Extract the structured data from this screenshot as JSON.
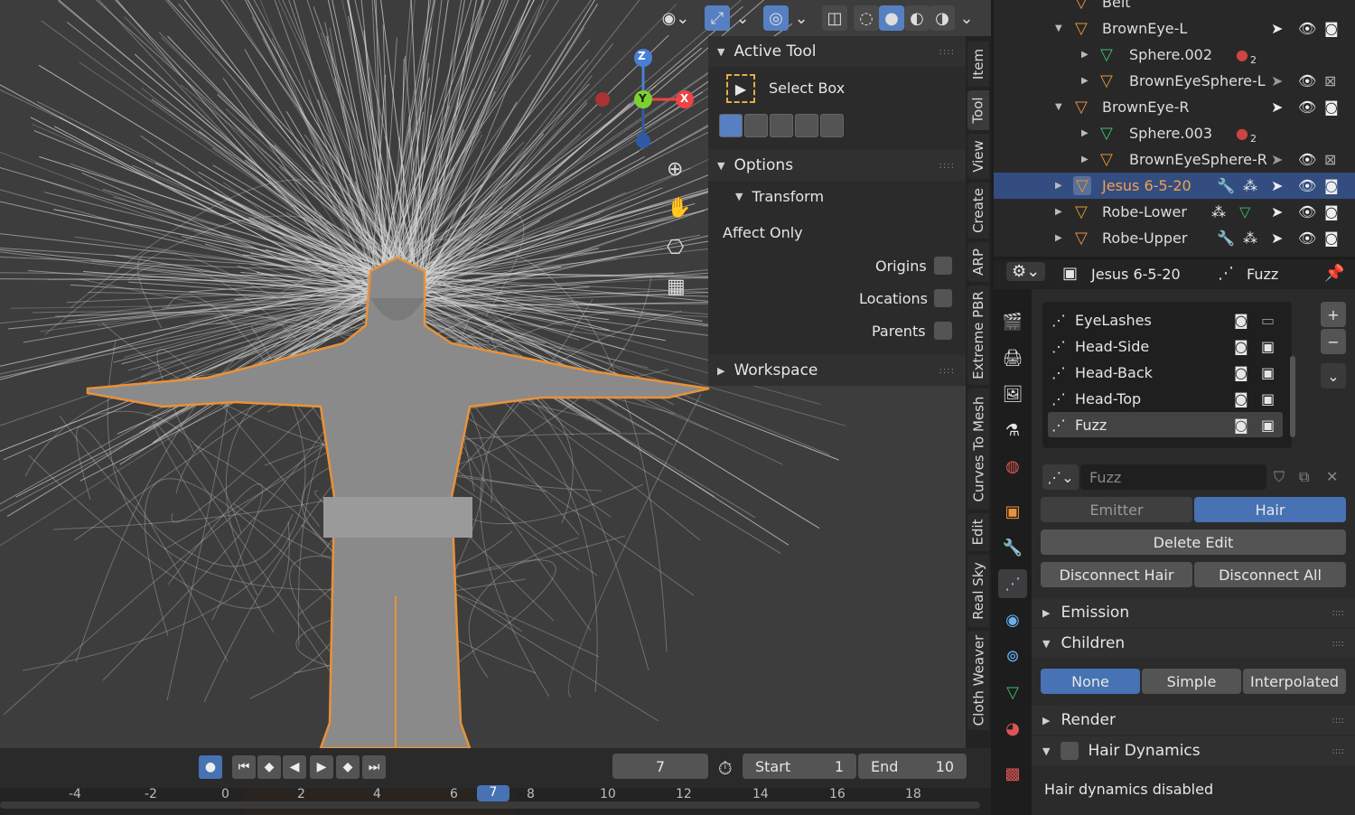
{
  "viewport": {
    "gizmo": {
      "z": "Z",
      "y": "Y",
      "x": "X"
    },
    "nav_icons": [
      "zoom-icon",
      "hand-icon",
      "camera-icon",
      "grid-icon"
    ]
  },
  "npanel": {
    "active_tool_header": "Active Tool",
    "tool_name": "Select Box",
    "options_header": "Options",
    "transform_header": "Transform",
    "affect_only": "Affect Only",
    "origins": "Origins",
    "locations": "Locations",
    "parents": "Parents",
    "workspace_header": "Workspace",
    "grip": "::::"
  },
  "vtabs": [
    "Item",
    "Tool",
    "View",
    "Create",
    "ARP",
    "Extreme PBR",
    "Curves To Mesh",
    "Edit",
    "Real Sky",
    "Cloth Weaver"
  ],
  "timeline": {
    "current_frame": "7",
    "start_label": "Start",
    "start_value": "1",
    "end_label": "End",
    "end_value": "10",
    "ticks": [
      "-4",
      "-2",
      "0",
      "2",
      "4",
      "6",
      "7",
      "8",
      "10",
      "12",
      "14",
      "16",
      "18"
    ]
  },
  "outliner": {
    "rows": [
      {
        "name": "Belt",
        "indent": 0
      },
      {
        "name": "BrownEye-L",
        "indent": 0
      },
      {
        "name": "Sphere.002",
        "indent": 1,
        "badge": "2"
      },
      {
        "name": "BrownEyeSphere-L",
        "indent": 1
      },
      {
        "name": "BrownEye-R",
        "indent": 0
      },
      {
        "name": "Sphere.003",
        "indent": 1,
        "badge": "2"
      },
      {
        "name": "BrownEyeSphere-R",
        "indent": 1
      },
      {
        "name": "Jesus 6-5-20",
        "indent": 0,
        "selected": true
      },
      {
        "name": "Robe-Lower",
        "indent": 0
      },
      {
        "name": "Robe-Upper",
        "indent": 0
      }
    ]
  },
  "properties": {
    "object_name": "Jesus 6-5-20",
    "system_name": "Fuzz",
    "particle_systems": [
      "EyeLashes",
      "Head-Side",
      "Head-Back",
      "Head-Top",
      "Fuzz"
    ],
    "settings_name": "Fuzz",
    "type_emitter": "Emitter",
    "type_hair": "Hair",
    "delete_edit": "Delete Edit",
    "disconnect_hair": "Disconnect Hair",
    "disconnect_all": "Disconnect All",
    "emission": "Emission",
    "children": "Children",
    "child_none": "None",
    "child_simple": "Simple",
    "child_interpolated": "Interpolated",
    "render": "Render",
    "hair_dynamics": "Hair Dynamics",
    "dynamics_status": "Hair dynamics disabled"
  },
  "colors": {
    "accent": "#4772b3",
    "selection_outline": "#e8923a",
    "outliner_selected": "#334d80"
  }
}
